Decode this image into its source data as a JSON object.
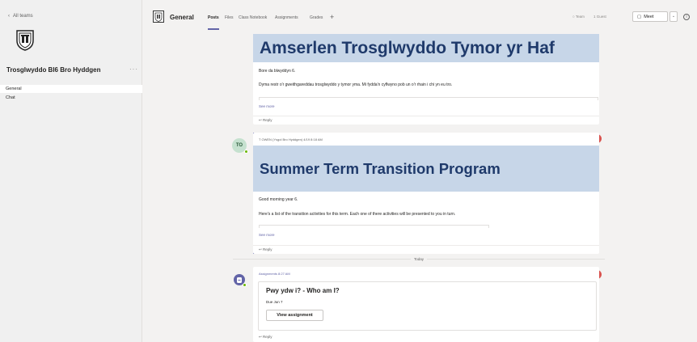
{
  "sidebar": {
    "back_label": "All teams",
    "team_name": "Trosglwyddo Bl6 Bro Hyddgen",
    "more_label": "···",
    "channels": [
      "General",
      "Chat"
    ]
  },
  "header": {
    "channel_title": "General",
    "tabs": [
      "Posts",
      "Files",
      "Class Notebook",
      "Assignments",
      "Grades"
    ],
    "add_tab": "+",
    "team_label": "Team",
    "guest_label": "1 Guest",
    "meet_label": "Meet",
    "meet_dropdown": "⌄",
    "info_label": "i"
  },
  "posts": [
    {
      "banner_title": "Amserlen Trosglwyddo Tymor yr Haf",
      "line1": "Bore da blwyddyn 6.",
      "line2": "Dyma restr o'r gweithgareddau trosglwyddo y tymor yma. Mi fydda'n cyflwyno pob un o'r rhain i chi yn eu tro.",
      "see_more": "See more",
      "reply": "Reply"
    },
    {
      "avatar_initials": "TO",
      "author_meta": "T OWEN (Ysgol Bro Hyddgen)  4/19 8:18 AM",
      "likes": "4",
      "banner_title": "Summer Term Transition Program",
      "line1": "Good morning year 6.",
      "line2": "Here's a list of the transition activities for this term. Each one of there activities will be presented to you in turn.",
      "see_more": "See more",
      "reply": "Reply"
    },
    {
      "author_meta": "Assignments  8:27 AM",
      "title": "Pwy ydw i? - Who am I?",
      "due": "Due Jun 7",
      "button": "View assignment",
      "reply": "Reply"
    }
  ],
  "separator_label": "Today",
  "colors": {
    "accent": "#6264a7",
    "banner": "#c7d6e8",
    "banner_text": "#1f3a6b",
    "reaction": "#d9534f"
  }
}
